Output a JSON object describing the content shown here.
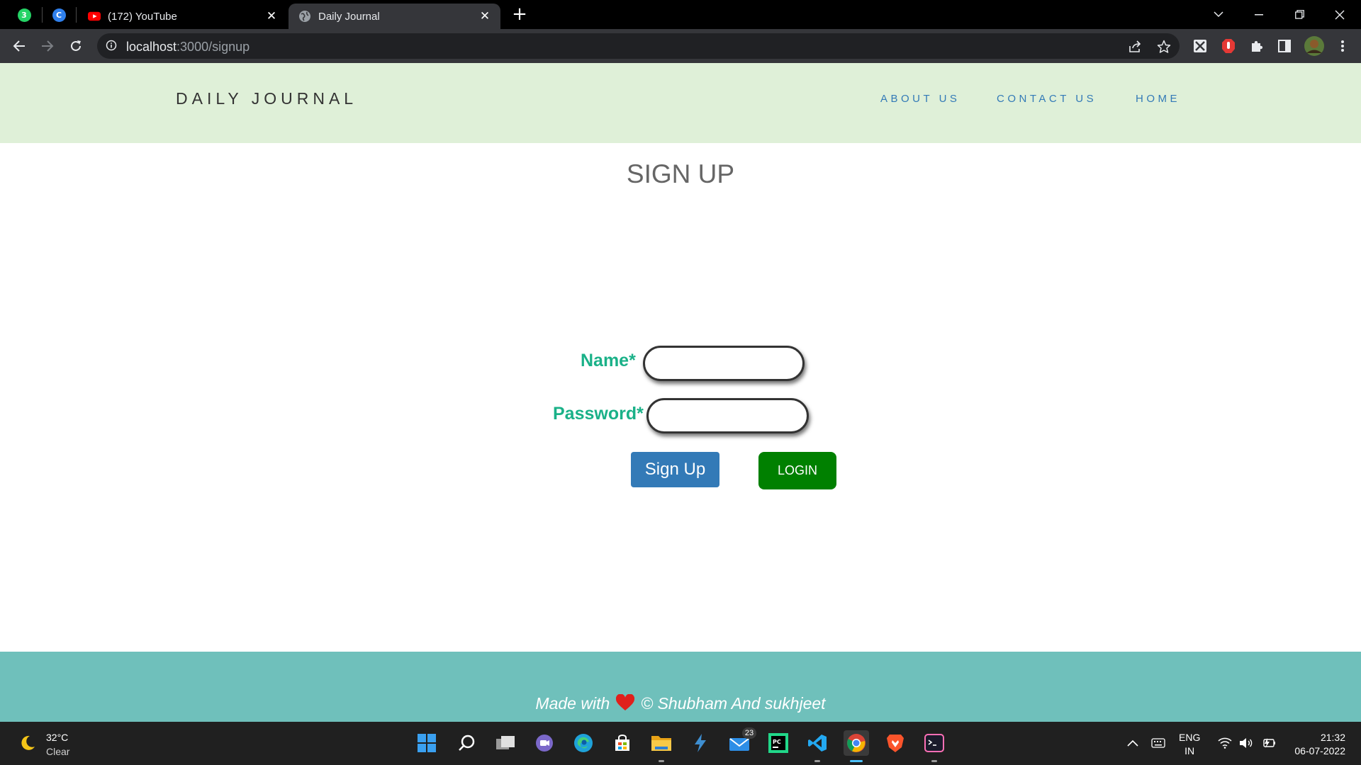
{
  "browser": {
    "pinned_tabs": [
      {
        "name": "whatsapp",
        "badge": "3",
        "color": "#25d366"
      },
      {
        "name": "canva",
        "badge": "C",
        "color": "#2f80ed"
      }
    ],
    "tabs": [
      {
        "title": "(172) YouTube",
        "active": false
      },
      {
        "title": "Daily Journal",
        "active": true
      }
    ],
    "url_host": "localhost",
    "url_path": ":3000/signup"
  },
  "site": {
    "brand": "DAILY JOURNAL",
    "nav": [
      "ABOUT US",
      "CONTACT US",
      "HOME"
    ],
    "title": "SIGN UP",
    "form": {
      "name_label": "Name*",
      "password_label": "Password*",
      "name_value": "",
      "password_value": ""
    },
    "buttons": {
      "signup": "Sign Up",
      "login": "LOGIN"
    },
    "footer": {
      "prefix": "Made with",
      "suffix": "© Shubham And sukhjeet"
    },
    "colors": {
      "nav_bg": "#dff0d8",
      "label": "#1ab188",
      "signup_btn": "#337ab7",
      "login_btn": "#008000",
      "footer_bg": "#6fc0bb"
    }
  },
  "taskbar": {
    "weather": {
      "temp": "32°C",
      "desc": "Clear"
    },
    "mail_badge": "23",
    "language": {
      "line1": "ENG",
      "line2": "IN"
    },
    "time": "21:32",
    "date": "06-07-2022"
  }
}
